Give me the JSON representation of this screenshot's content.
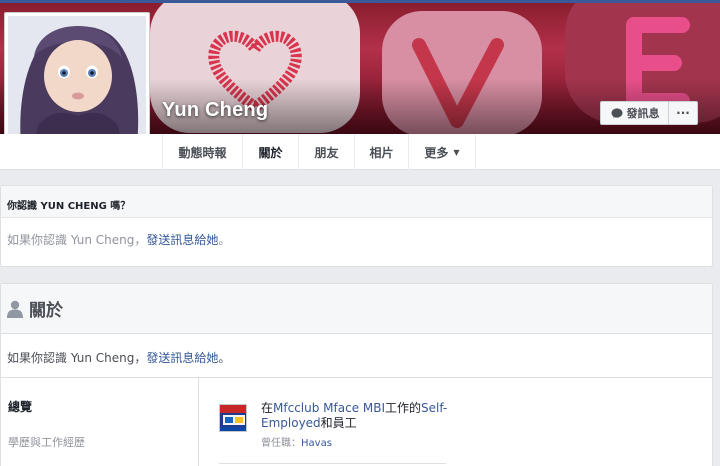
{
  "profile": {
    "name": "Yun Cheng"
  },
  "cover_actions": {
    "message_label": "發訊息",
    "more_label": "···"
  },
  "tabs": [
    {
      "label": "動態時報"
    },
    {
      "label": "關於"
    },
    {
      "label": "朋友"
    },
    {
      "label": "相片"
    },
    {
      "label": "更多"
    }
  ],
  "know_card": {
    "heading": "你認識 YUN CHENG 嗎？",
    "prefix": "如果你認識 Yun Cheng，",
    "link": "發送訊息給她",
    "suffix": "。"
  },
  "about": {
    "title": "關於",
    "know_prefix": "如果你認識 Yun Cheng，",
    "know_link": "發送訊息給她",
    "know_suffix": "。",
    "nav": [
      "總覽",
      "學歷與工作經歷"
    ],
    "work": {
      "pre": "在",
      "company": "Mfcclub Mface MBI",
      "mid": "工作的",
      "role": "Self-Employed",
      "post": "和員工",
      "former_label": "曾任職：",
      "former": "Havas"
    }
  },
  "colors": {
    "brand": "#3b5998",
    "link": "#365899",
    "muted": "#90949c"
  }
}
